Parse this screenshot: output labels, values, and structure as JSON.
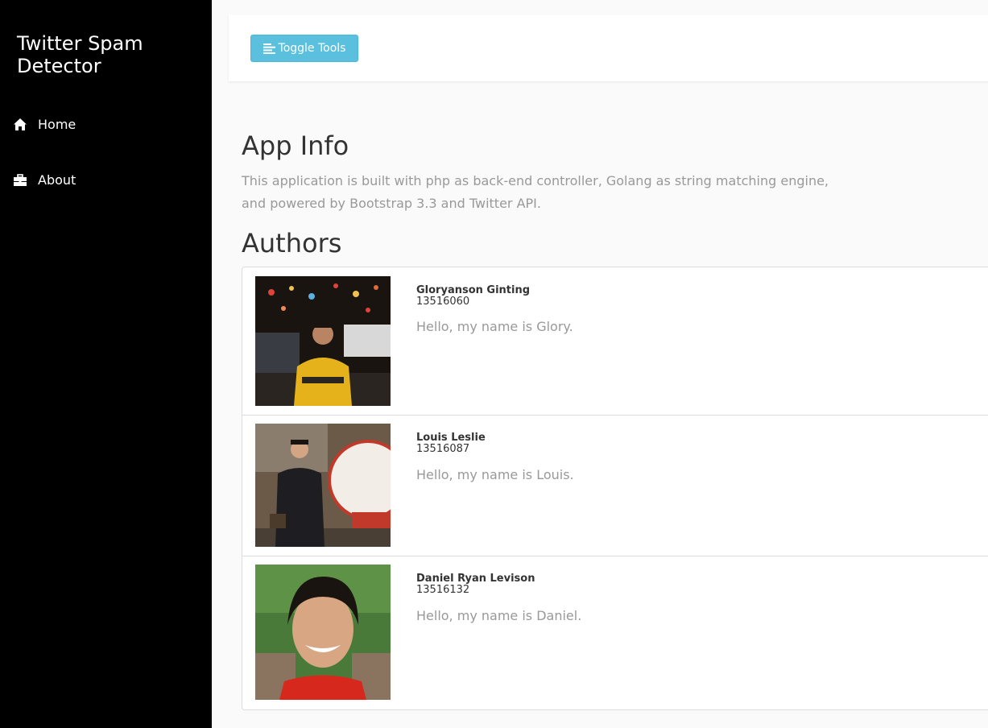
{
  "sidebar": {
    "brand": "Twitter Spam Detector",
    "items": [
      {
        "label": "Home",
        "icon": "home-icon"
      },
      {
        "label": "About",
        "icon": "briefcase-icon"
      }
    ]
  },
  "topbar": {
    "toggle_label": "Toggle Tools",
    "toggle_icon": "align-left-icon",
    "toggle_color": "#5bc0de"
  },
  "app_info": {
    "title": "App Info",
    "description": "This application is built with php as back-end controller, Golang as string matching engine, and powered by Bootstrap 3.3 and Twitter API."
  },
  "authors": {
    "title": "Authors",
    "list": [
      {
        "name": "Gloryanson Ginting",
        "id": "13516060",
        "bio": "Hello, my name is Glory."
      },
      {
        "name": "Louis Leslie",
        "id": "13516087",
        "bio": "Hello, my name is Louis."
      },
      {
        "name": "Daniel Ryan Levison",
        "id": "13516132",
        "bio": "Hello, my name is Daniel."
      }
    ]
  }
}
